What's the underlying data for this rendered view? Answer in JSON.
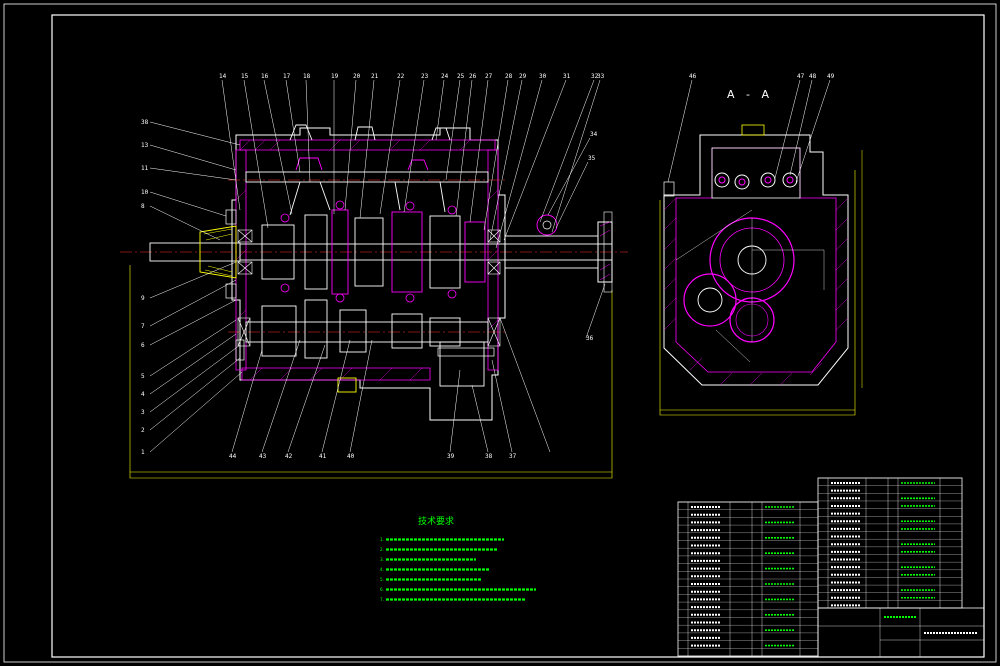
{
  "section_title": "A - A",
  "tech": {
    "title": "技术要求",
    "lines": [
      "1.",
      "2.",
      "3.",
      "4.",
      "5.",
      "6.",
      "7."
    ]
  },
  "colors": {
    "background": "#000000",
    "outline": "#ffffff",
    "part": "#ff00ff",
    "dimension": "#ffff00",
    "leader": "#ffffff",
    "text_green": "#00ff00",
    "centerline": "#ff3030"
  },
  "top_labels": [
    "14",
    "15",
    "16",
    "17",
    "18",
    "19",
    "20",
    "21",
    "22",
    "23",
    "24",
    "25",
    "26",
    "27",
    "28",
    "29",
    "30",
    "31",
    "32",
    "33"
  ],
  "left_labels": [
    "38",
    "13",
    "11",
    "10",
    "8",
    "9",
    "7",
    "6",
    "5",
    "4",
    "3",
    "2",
    "1"
  ],
  "bottom_labels": [
    "44",
    "43",
    "42",
    "41",
    "40",
    "39",
    "38",
    "37"
  ],
  "right_labels": [
    "34",
    "35",
    "36"
  ],
  "section_labels": [
    "46",
    "47",
    "48",
    "49"
  ]
}
